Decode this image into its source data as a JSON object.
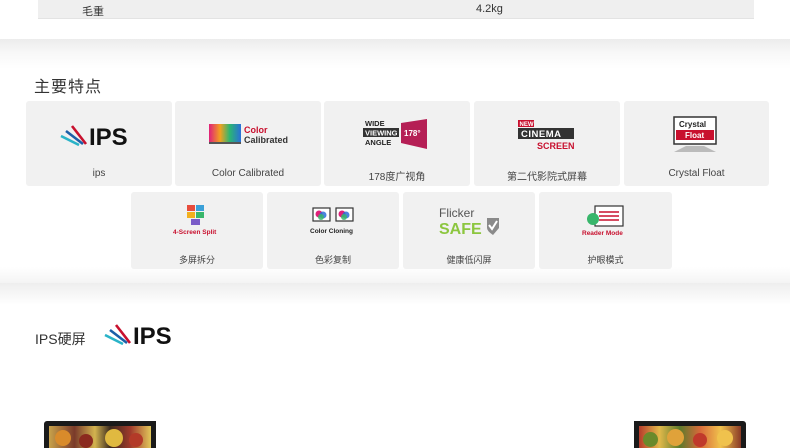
{
  "spec": {
    "label": "毛重",
    "value": "4.2kg"
  },
  "features": {
    "title": "主要特点",
    "items": [
      {
        "caption": "ips",
        "icon": "ips-logo-icon"
      },
      {
        "caption": "Color Calibrated",
        "icon": "color-calibrated-icon",
        "logo_line1": "Color",
        "logo_line2": "Calibrated"
      },
      {
        "caption": "178度广视角",
        "icon": "wide-viewing-angle-icon",
        "logo_line1": "WIDE",
        "logo_line2": "VIEWING",
        "logo_line3": "ANGLE",
        "logo_badge": "178°"
      },
      {
        "caption": "第二代影院式屏幕",
        "icon": "cinema-screen-icon",
        "logo_badge": "NEW",
        "logo_line1": "CINEMA",
        "logo_line2": "SCREEN"
      },
      {
        "caption": "Crystal Float",
        "icon": "crystal-float-icon",
        "logo_line1": "Crystal",
        "logo_line2": "Float"
      },
      {
        "caption": "多屏拆分",
        "icon": "four-screen-split-icon",
        "logo_line1": "4-Screen Split"
      },
      {
        "caption": "色彩复制",
        "icon": "color-cloning-icon",
        "logo_line1": "Color Cloning"
      },
      {
        "caption": "健康低闪屏",
        "icon": "flicker-safe-icon",
        "logo_line1": "Flicker",
        "logo_line2": "SAFE"
      },
      {
        "caption": "护眼模式",
        "icon": "reader-mode-icon",
        "logo_line1": "Reader Mode"
      }
    ]
  },
  "ips_section": {
    "title": "IPS硬屏",
    "logo_text": "IPS"
  },
  "colors": {
    "accent_red": "#c8102e",
    "card_bg": "#f1f1f1",
    "text": "#333333",
    "ips_stripe_1": "#2ab3c8",
    "ips_stripe_2": "#1b5fa8",
    "ips_stripe_3": "#c8102e"
  }
}
